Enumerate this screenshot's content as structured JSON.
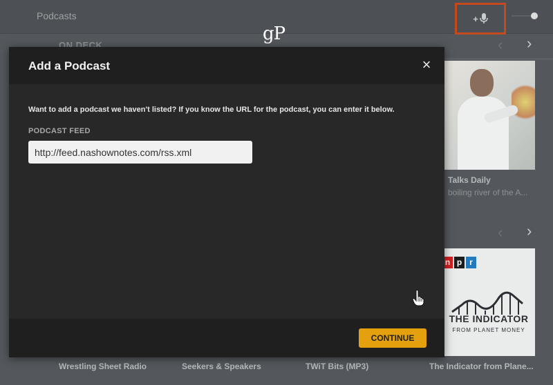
{
  "header": {
    "title": "Podcasts",
    "add_icon_label": "+"
  },
  "watermark": "gP",
  "sections": {
    "on_deck": "ON DECK"
  },
  "cards": {
    "ted": {
      "title": "Talks Daily",
      "subtitle": "boiling river of the A..."
    },
    "indicator": {
      "npr_letters": [
        "n",
        "p",
        "r"
      ],
      "art_title": "THE INDICATOR",
      "art_subtitle": "FROM PLANET MONEY"
    }
  },
  "bottom_row": [
    "Wrestling Sheet Radio",
    "Seekers & Speakers",
    "TWiT Bits (MP3)",
    "The Indicator from Plane..."
  ],
  "dialog": {
    "title": "Add a Podcast",
    "close_label": "×",
    "description": "Want to add a podcast we haven't listed? If you know the URL for the podcast, you can enter it below.",
    "feed_label": "PODCAST FEED",
    "feed_value": "http://feed.nashownotes.com/rss.xml",
    "continue_label": "CONTINUE"
  },
  "colors": {
    "accent": "#e5a00d",
    "highlight": "#c44a1e",
    "npr_red": "#d62021",
    "npr_black": "#1c1c1c",
    "npr_blue": "#237bbd"
  }
}
